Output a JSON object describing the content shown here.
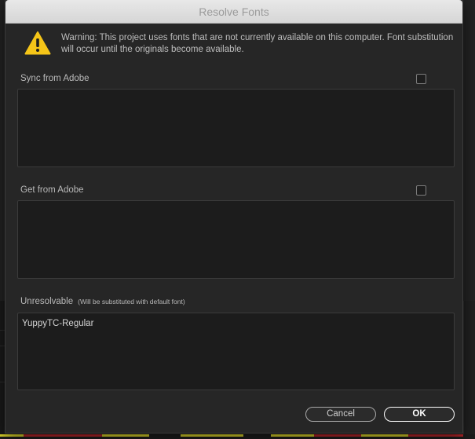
{
  "dialog": {
    "title": "Resolve Fonts",
    "warning": "Warning: This project uses fonts that are not currently available on this computer. Font substitution will occur until the originals become available."
  },
  "sections": {
    "sync": {
      "label": "Sync from Adobe",
      "checked": false
    },
    "get": {
      "label": "Get from Adobe",
      "checked": false
    },
    "unresolvable": {
      "label": "Unresolvable",
      "note": "(Will be substituted with default font)",
      "fonts": [
        "YuppyTC-Regular"
      ]
    }
  },
  "buttons": {
    "cancel": "Cancel",
    "ok": "OK"
  },
  "colors": {
    "warning_icon": "#f5c518",
    "timeline_yellow": "#d9d22a",
    "timeline_red": "#b5262a"
  }
}
